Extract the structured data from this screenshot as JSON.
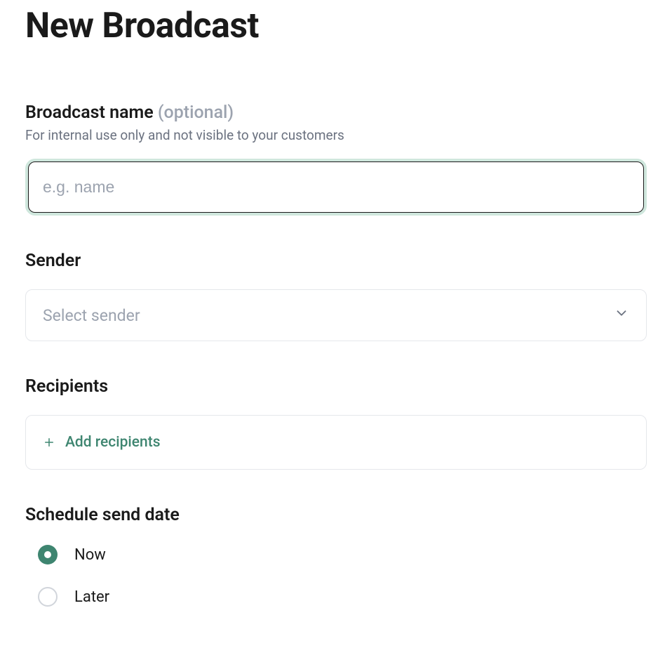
{
  "page": {
    "title": "New Broadcast"
  },
  "broadcast_name": {
    "label": "Broadcast name",
    "optional_label": "(optional)",
    "description": "For internal use only and not visible to your customers",
    "placeholder": "e.g. name",
    "value": ""
  },
  "sender": {
    "label": "Sender",
    "placeholder": "Select sender"
  },
  "recipients": {
    "label": "Recipients",
    "add_label": "Add recipients"
  },
  "schedule": {
    "label": "Schedule send date",
    "options": {
      "now": "Now",
      "later": "Later"
    },
    "selected": "now"
  }
}
